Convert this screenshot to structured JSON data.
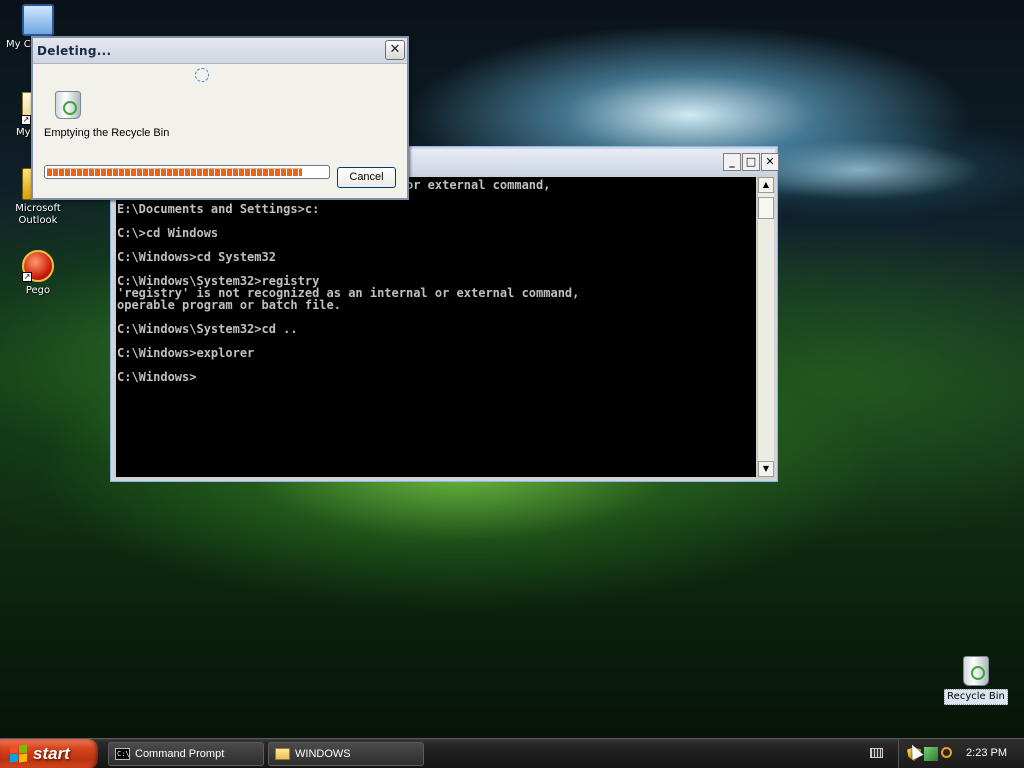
{
  "desktop": {
    "icons": [
      {
        "label": "My C"
      },
      {
        "label": "My"
      },
      {
        "label": "Microsoft Outlook"
      },
      {
        "label": "Pego"
      },
      {
        "label": "Recycle Bin"
      }
    ]
  },
  "console": {
    "title": "",
    "lines": [
      "                                      l or external command,",
      "",
      "E:\\Documents and Settings>c:",
      "",
      "C:\\>cd Windows",
      "",
      "C:\\Windows>cd System32",
      "",
      "C:\\Windows\\System32>registry",
      "'registry' is not recognized as an internal or external command,",
      "operable program or batch file.",
      "",
      "C:\\Windows\\System32>cd ..",
      "",
      "C:\\Windows>explorer",
      "",
      "C:\\Windows>"
    ],
    "buttons": {
      "minimize": "_",
      "maximize": "□",
      "close": "✕"
    }
  },
  "dialog": {
    "title": "Deleting...",
    "message": "Emptying the Recycle Bin",
    "progress": 0.91,
    "cancel_label": "Cancel",
    "close": "✕"
  },
  "taskbar": {
    "start_label": "start",
    "tasks": [
      {
        "label": "Command Prompt",
        "icon": "cmd-icon"
      },
      {
        "label": "WINDOWS",
        "icon": "folder-icon"
      }
    ],
    "clock": "2:23 PM"
  },
  "colors": {
    "progress_fill": "#e8661c",
    "start_button": "#d8461f",
    "console_bg": "#000000",
    "console_text": "#c0c0c0"
  }
}
